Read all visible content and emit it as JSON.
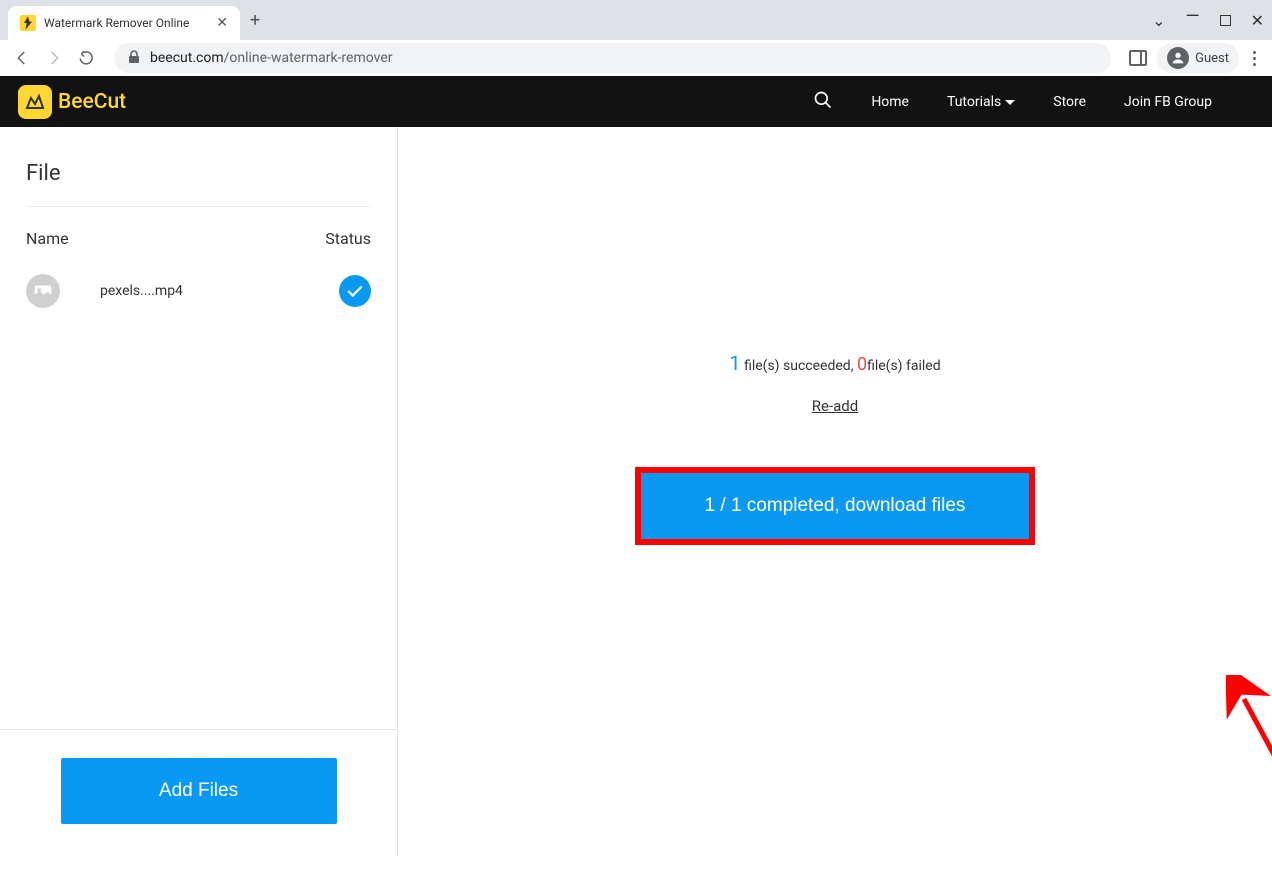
{
  "browser": {
    "tab_title": "Watermark Remover Online",
    "url_domain": "beecut.com",
    "url_path": "/online-watermark-remover",
    "guest_label": "Guest"
  },
  "header": {
    "logo_text": "BeeCut",
    "nav": {
      "home": "Home",
      "tutorials": "Tutorials",
      "store": "Store",
      "join_group": "Join FB Group"
    }
  },
  "sidebar": {
    "heading": "File",
    "col_name": "Name",
    "col_status": "Status",
    "files": [
      {
        "name": "pexels....mp4"
      }
    ],
    "add_files_label": "Add Files"
  },
  "main": {
    "succeeded_count": "1",
    "succeeded_text": " file(s) succeeded, ",
    "failed_count": "0",
    "failed_text": "file(s) failed",
    "readd_label": "Re-add",
    "download_label": "1 / 1 completed, download files"
  }
}
